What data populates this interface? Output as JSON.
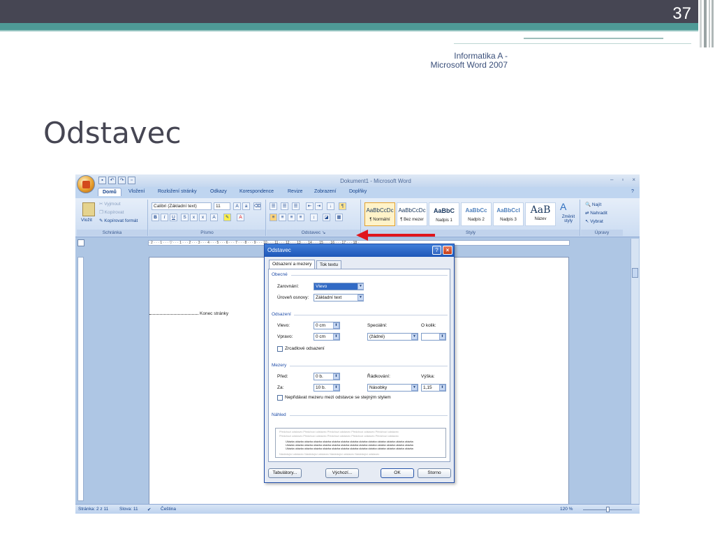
{
  "slide": {
    "number": "37",
    "subtitle_line1": "Informatika A -",
    "subtitle_line2": "Microsoft Word 2007",
    "title": "Odstavec",
    "colors": {
      "topbar": "#464653",
      "teal": "#4e9a96",
      "arrow": "#e0151c"
    }
  },
  "word": {
    "window_title": "Dokument1 - Microsoft Word",
    "window_controls": [
      "–",
      "▫",
      "×"
    ],
    "tabs": [
      "Domů",
      "Vložení",
      "Rozložení stránky",
      "Odkazy",
      "Korespondence",
      "Revize",
      "Zobrazení",
      "Doplňky"
    ],
    "clipboard": {
      "paste": "Vložit",
      "cut": "Vyjmout",
      "copy": "Kopírovat",
      "format": "Kopírovat formát",
      "label": "Schránka"
    },
    "font": {
      "name": "Calibri (Základní text)",
      "size": "11",
      "label": "Písmo"
    },
    "paragraph_label": "Odstavec",
    "styles": {
      "label": "Styly",
      "items": [
        {
          "sample": "AaBbCcDc",
          "name": "¶ Normální"
        },
        {
          "sample": "AaBbCcDc",
          "name": "¶ Bez mezer"
        },
        {
          "sample": "AaBbC",
          "name": "Nadpis 1"
        },
        {
          "sample": "AaBbCc",
          "name": "Nadpis 2"
        },
        {
          "sample": "AaBbCcI",
          "name": "Nadpis 3"
        },
        {
          "sample": "AaB",
          "name": "Název"
        }
      ],
      "change": "Změnit styly"
    },
    "editing": {
      "find": "Najít",
      "replace": "Nahradit",
      "select": "Vybrat",
      "label": "Úpravy"
    },
    "ruler_text": "· 2 · · · 1 · · · ▽ · · · 1 · · · 2 · · · 3 · · · 4 · · · 5 · · · 6 · · · 7 · · · 8 · · · 9 · · · 10 · · · 11 · · · 12 · · · 13 · · · 14 · · · 15 · · · 16 · · · 17 · · · 18 ·",
    "page_break": "Konec stránky",
    "status": {
      "page": "Stránka: 2 z 11",
      "words": "Slova: 11",
      "lang": "Čeština",
      "zoom": "120 %"
    }
  },
  "dialog": {
    "title": "Odstavec",
    "tabs": [
      "Odsazení a mezery",
      "Tok textu"
    ],
    "general": {
      "heading": "Obecné",
      "alignment_label": "Zarovnání:",
      "alignment_value": "Vlevo",
      "outline_label": "Úroveň osnovy:",
      "outline_value": "Základní text"
    },
    "indent": {
      "heading": "Odsazení",
      "left_label": "Vlevo:",
      "left_value": "0 cm",
      "right_label": "Vpravo:",
      "right_value": "0 cm",
      "special_label": "Speciální:",
      "special_value": "(žádné)",
      "by_label": "O kolik:",
      "mirror_label": "Zrcadlové odsazení"
    },
    "spacing": {
      "heading": "Mezery",
      "before_label": "Před:",
      "before_value": "0 b.",
      "after_label": "Za:",
      "after_value": "10 b.",
      "line_label": "Řádkování:",
      "line_value": "Násobky",
      "at_label": "Výška:",
      "at_value": "1,15",
      "dont_add_label": "Nepřidávat mezeru mezi odstavce se stejným stylem"
    },
    "preview": {
      "heading": "Náhled",
      "prev_text": "Předchozí odstavec Předchozí odstavec Předchozí odstavec Předchozí odstavec Předchozí odstavec",
      "sample_text": "Ukázka ukázka ukázka ukázka ukázka ukázka ukázka ukázka ukázka ukázka ukázka ukázka ukázka ukázka",
      "next_text": "Následující odstavec Následující odstavec Následující odstavec Následující odstavec"
    },
    "buttons": {
      "tabs": "Tabulátory...",
      "default": "Výchozí...",
      "ok": "OK",
      "cancel": "Storno"
    }
  }
}
